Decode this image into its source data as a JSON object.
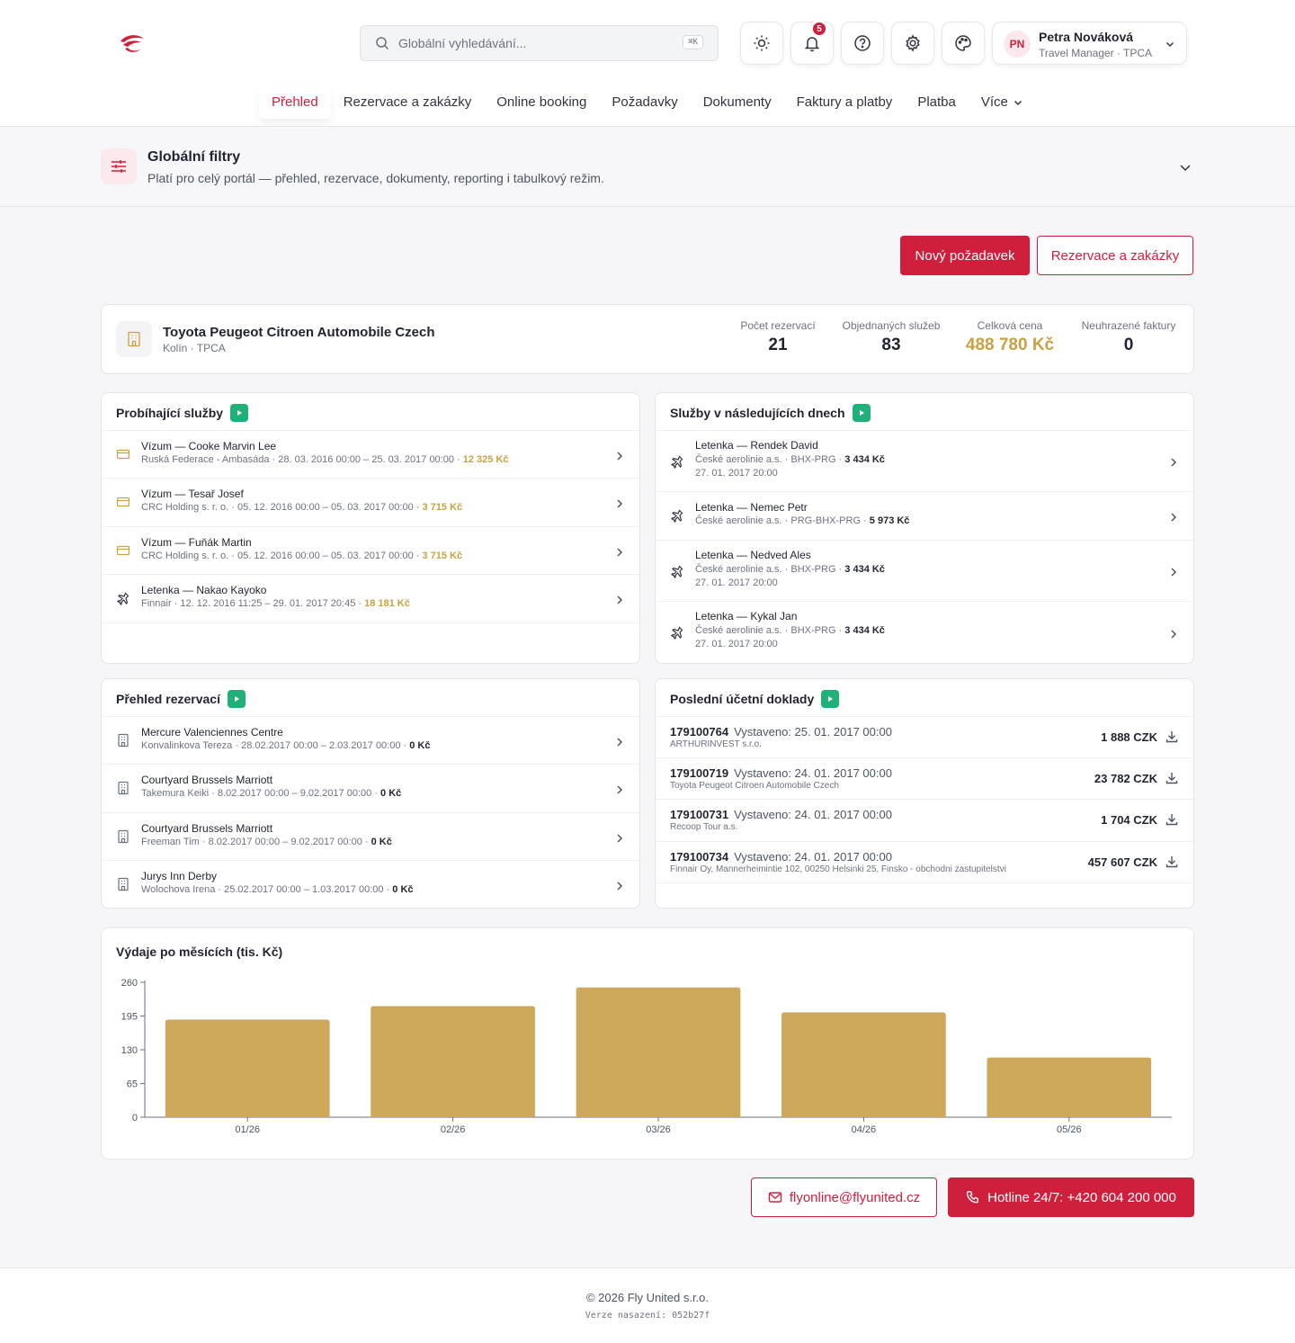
{
  "header": {
    "search_placeholder": "Globální vyhledávání...",
    "search_shortcut": "⌘K",
    "notifications_count": "5",
    "user": {
      "initials": "PN",
      "name": "Petra Nováková",
      "role": "Travel Manager · TPCA"
    }
  },
  "nav": {
    "items": [
      "Přehled",
      "Rezervace a zakázky",
      "Online booking",
      "Požadavky",
      "Dokumenty",
      "Faktury a platby",
      "Platba",
      "Více"
    ],
    "active": "Přehled"
  },
  "filters": {
    "title": "Globální filtry",
    "subtitle": "Platí pro celý portál — přehled, rezervace, dokumenty, reporting i tabulkový režim."
  },
  "actions": {
    "new_request": "Nový požadavek",
    "reservations": "Rezervace a zakázky"
  },
  "company": {
    "name": "Toyota Peugeot Citroen Automobile Czech",
    "location": "Kolín · TPCA",
    "stats": [
      {
        "label": "Počet rezervací",
        "value": "21"
      },
      {
        "label": "Objednaných služeb",
        "value": "83"
      },
      {
        "label": "Celková cena",
        "value": "488 780 Kč"
      },
      {
        "label": "Neuhrazené faktury",
        "value": "0"
      }
    ]
  },
  "ongoing": {
    "title": "Probíhající služby",
    "items": [
      {
        "title": "Vízum — Cooke Marvin Lee",
        "detail": "Ruská Federace - Ambasáda · 28. 03. 2016 00:00 – 25. 03. 2017 00:00 · ",
        "price": "12 325 Kč",
        "icon": "visa-card"
      },
      {
        "title": "Vízum — Tesař Josef",
        "detail": "CRC Holding s. r. o. · 05. 12. 2016 00:00 – 05. 03. 2017 00:00 · ",
        "price": "3 715 Kč",
        "icon": "visa-card"
      },
      {
        "title": "Vízum — Fuňák Martin",
        "detail": "CRC Holding s. r. o. · 05. 12. 2016 00:00 – 05. 03. 2017 00:00 · ",
        "price": "3 715 Kč",
        "icon": "visa-card"
      },
      {
        "title": "Letenka — Nakao Kayoko",
        "detail": "Finnair · 12. 12. 2016 11:25 – 29. 01. 2017 20:45 · ",
        "price": "18 181 Kč",
        "icon": "plane"
      }
    ]
  },
  "upcoming": {
    "title": "Služby v následujících dnech",
    "items": [
      {
        "title": "Letenka — Rendek David",
        "detail": "České aerolinie a.s. · BHX-PRG · ",
        "price": "3 434 Kč",
        "date": "27. 01. 2017 20:00",
        "icon": "plane"
      },
      {
        "title": "Letenka — Nemec Petr",
        "detail": "České aerolinie a.s. · PRG-BHX-PRG · ",
        "price": "5 973 Kč",
        "date": "",
        "icon": "plane"
      },
      {
        "title": "Letenka — Nedved Ales",
        "detail": "České aerolinie a.s. · BHX-PRG · ",
        "price": "3 434 Kč",
        "date": "27. 01. 2017 20:00",
        "icon": "plane"
      },
      {
        "title": "Letenka — Kykal Jan",
        "detail": "České aerolinie a.s. · BHX-PRG · ",
        "price": "3 434 Kč",
        "date": "27. 01. 2017 20:00",
        "icon": "plane"
      }
    ]
  },
  "reservations": {
    "title": "Přehled rezervací",
    "items": [
      {
        "title": "Mercure Valenciennes Centre",
        "detail": "Konvalinkova Tereza · 28.02.2017 00:00 – 2.03.2017 00:00 · ",
        "price": "0 Kč",
        "icon": "building"
      },
      {
        "title": "Courtyard Brussels Marriott",
        "detail": "Takemura Keiki · 8.02.2017 00:00 – 9.02.2017 00:00 · ",
        "price": "0 Kč",
        "icon": "building"
      },
      {
        "title": "Courtyard Brussels Marriott",
        "detail": "Freeman Tim · 8.02.2017 00:00 – 9.02.2017 00:00 · ",
        "price": "0 Kč",
        "icon": "building"
      },
      {
        "title": "Jurys Inn Derby",
        "detail": "Wolochova Irena · 25.02.2017 00:00 – 1.03.2017 00:00 · ",
        "price": "0 Kč",
        "icon": "building"
      }
    ]
  },
  "invoices": {
    "title": "Poslední účetní doklady",
    "items": [
      {
        "number": "179100764",
        "issued": "Vystaveno: 25. 01. 2017 00:00",
        "company": "ARTHURINVEST s.r.o.",
        "amount": "1 888 CZK"
      },
      {
        "number": "179100719",
        "issued": "Vystaveno: 24. 01. 2017 00:00",
        "company": "Toyota Peugeot Citroen Automobile Czech",
        "amount": "23 782 CZK"
      },
      {
        "number": "179100731",
        "issued": "Vystaveno: 24. 01. 2017 00:00",
        "company": "Recoop Tour a.s.",
        "amount": "1 704 CZK"
      },
      {
        "number": "179100734",
        "issued": "Vystaveno: 24. 01. 2017 00:00",
        "company": "Finnair Oy, Mannerheimintie 102, 00250 Helsinki 25, Finsko - obchodni zastupitelstvi",
        "amount": "457 607 CZK"
      }
    ]
  },
  "chart_data": {
    "type": "bar",
    "title": "Výdaje po měsících (tis. Kč)",
    "categories": [
      "01/26",
      "02/26",
      "03/26",
      "04/26",
      "05/26"
    ],
    "values": [
      188,
      214,
      250,
      202,
      115
    ],
    "ylim": [
      0,
      260
    ],
    "yticks": [
      0,
      65,
      130,
      195,
      260
    ],
    "bar_color": "#cda85a",
    "grid": false
  },
  "contact": {
    "email": "flyonline@flyunited.cz",
    "hotline": "Hotline 24/7: +420 604 200 000"
  },
  "footer": {
    "copyright": "© 2026 Fly United s.r.o.",
    "version": "Verze nasazení: 052b27f"
  },
  "colors": {
    "brand": "#d01f3c",
    "gold": "#c9a042",
    "success": "#20b07a"
  }
}
